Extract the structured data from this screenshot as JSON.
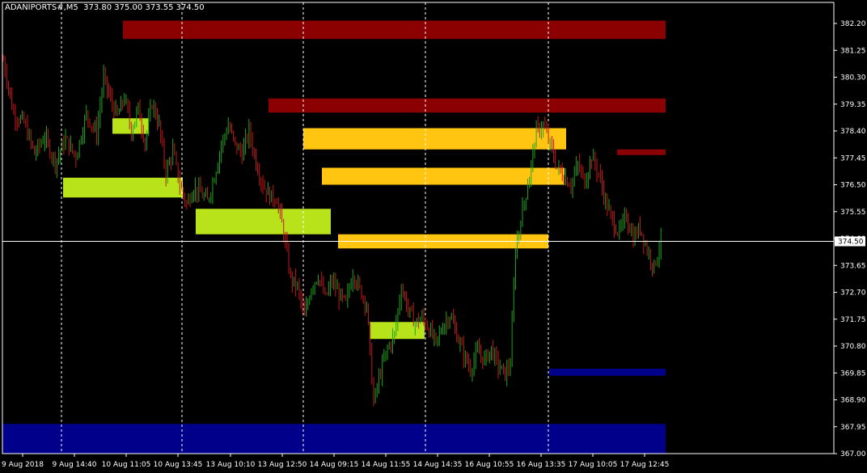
{
  "header": {
    "symbol": "ADANIPORTS#,M5",
    "ohlc": "373.80 375.00 373.55 374.50"
  },
  "colors": {
    "background": "#000000",
    "bull": "#1fa51f",
    "bear": "#c41a1a",
    "supply_zone": "#8b0000",
    "demand_zone": "#00008b",
    "lime_zone": "#b8e21a",
    "orange_zone": "#ffc510",
    "grid": "#ffffff",
    "text": "#ffffff"
  },
  "chart_data": {
    "type": "candlestick",
    "y_ticks": [
      "382.20",
      "381.25",
      "380.30",
      "379.35",
      "378.40",
      "377.45",
      "376.50",
      "375.55",
      "374.60",
      "373.65",
      "372.70",
      "371.75",
      "370.80",
      "369.85",
      "368.90",
      "367.95",
      "367.00"
    ],
    "ylim": [
      367.0,
      382.2
    ],
    "x_ticks": [
      "9 Aug 2018",
      "9 Aug 14:40",
      "10 Aug 11:05",
      "10 Aug 13:45",
      "13 Aug 10:10",
      "13 Aug 12:50",
      "14 Aug 09:15",
      "14 Aug 11:55",
      "14 Aug 14:35",
      "16 Aug 10:55",
      "16 Aug 13:35",
      "17 Aug 10:05",
      "17 Aug 12:45"
    ],
    "current_price": "374.50",
    "current_value": 374.5,
    "bar_count": 205,
    "price_path": [
      [
        0,
        380.9
      ],
      [
        6,
        379.0
      ],
      [
        12,
        378.7
      ],
      [
        18,
        377.6
      ],
      [
        24,
        378.2
      ],
      [
        30,
        377.3
      ],
      [
        36,
        378.1
      ],
      [
        42,
        377.5
      ],
      [
        48,
        379.0
      ],
      [
        54,
        378.3
      ],
      [
        58,
        380.3
      ],
      [
        62,
        379.5
      ],
      [
        66,
        378.9
      ],
      [
        70,
        379.6
      ],
      [
        74,
        378.4
      ],
      [
        78,
        379.2
      ],
      [
        82,
        378.0
      ],
      [
        86,
        379.4
      ],
      [
        90,
        378.6
      ],
      [
        94,
        376.9
      ],
      [
        98,
        377.7
      ],
      [
        102,
        376.5
      ],
      [
        106,
        375.8
      ],
      [
        110,
        376.4
      ],
      [
        114,
        376.2
      ],
      [
        118,
        375.9
      ],
      [
        122,
        376.8
      ],
      [
        126,
        377.9
      ],
      [
        130,
        378.6
      ],
      [
        134,
        377.9
      ],
      [
        138,
        377.6
      ],
      [
        142,
        378.4
      ],
      [
        146,
        377.3
      ],
      [
        150,
        376.5
      ],
      [
        154,
        376.1
      ],
      [
        158,
        376.0
      ],
      [
        162,
        374.8
      ],
      [
        166,
        373.2
      ],
      [
        170,
        372.9
      ],
      [
        174,
        371.8
      ],
      [
        178,
        372.9
      ],
      [
        182,
        373.3
      ],
      [
        186,
        372.5
      ],
      [
        190,
        373.1
      ],
      [
        194,
        372.6
      ],
      [
        198,
        372.3
      ],
      [
        202,
        373.4
      ],
      [
        206,
        372.8
      ],
      [
        210,
        372.3
      ],
      [
        214,
        368.8
      ],
      [
        218,
        369.9
      ],
      [
        222,
        370.7
      ],
      [
        226,
        371.2
      ],
      [
        230,
        372.9
      ],
      [
        234,
        372.1
      ],
      [
        238,
        371.6
      ],
      [
        242,
        371.8
      ],
      [
        246,
        371.4
      ],
      [
        250,
        370.9
      ],
      [
        254,
        371.5
      ],
      [
        258,
        371.9
      ],
      [
        262,
        371.2
      ],
      [
        266,
        370.5
      ],
      [
        270,
        370.0
      ],
      [
        274,
        370.6
      ],
      [
        278,
        370.3
      ],
      [
        282,
        370.7
      ],
      [
        286,
        370.1
      ],
      [
        290,
        369.8
      ],
      [
        293,
        370.2
      ],
      [
        296,
        374.2
      ],
      [
        300,
        375.6
      ],
      [
        304,
        376.8
      ],
      [
        308,
        378.4
      ],
      [
        312,
        378.6
      ],
      [
        316,
        377.9
      ],
      [
        320,
        377.1
      ],
      [
        324,
        376.8
      ],
      [
        328,
        376.5
      ],
      [
        332,
        377.2
      ],
      [
        336,
        376.6
      ],
      [
        340,
        377.5
      ],
      [
        344,
        376.9
      ],
      [
        348,
        375.9
      ],
      [
        352,
        375.2
      ],
      [
        356,
        374.8
      ],
      [
        360,
        375.4
      ],
      [
        364,
        374.6
      ],
      [
        368,
        375.0
      ],
      [
        372,
        374.2
      ],
      [
        376,
        373.6
      ],
      [
        380,
        374.5
      ]
    ],
    "zones": [
      {
        "kind": "supply",
        "top": 382.3,
        "bottom": 381.65,
        "x_from": "10 Aug 11:05"
      },
      {
        "kind": "supply",
        "top": 379.55,
        "bottom": 379.05,
        "x_from": "13 Aug 10:10"
      },
      {
        "kind": "supply",
        "top": 377.75,
        "bottom": 377.55,
        "x_from": "17 Aug 10:05"
      },
      {
        "kind": "orange",
        "top": 378.5,
        "bottom": 377.75,
        "x_from": "13 Aug 12:50",
        "x_to": "16 Aug 13:35"
      },
      {
        "kind": "orange",
        "top": 377.1,
        "bottom": 376.5,
        "x_from": "13 Aug 12:50",
        "x_to": "16 Aug 13:35"
      },
      {
        "kind": "orange",
        "top": 374.75,
        "bottom": 374.25,
        "x_from": "14 Aug 09:15",
        "x_to": "16 Aug 13:35"
      },
      {
        "kind": "lime",
        "top": 378.85,
        "bottom": 378.3,
        "x_from": "10 Aug 11:05",
        "x_to": "10 Aug 13:45"
      },
      {
        "kind": "lime",
        "top": 376.75,
        "bottom": 376.05,
        "x_from": "9 Aug 14:40",
        "x_to": "10 Aug 13:45"
      },
      {
        "kind": "lime",
        "top": 375.65,
        "bottom": 374.75,
        "x_from": "10 Aug 13:45",
        "x_to": "14 Aug 09:15"
      },
      {
        "kind": "lime",
        "top": 371.65,
        "bottom": 371.05,
        "x_from": "14 Aug 11:55",
        "x_to": "14 Aug 14:35"
      },
      {
        "kind": "demand",
        "top": 370.0,
        "bottom": 369.75,
        "x_from": "16 Aug 13:35"
      },
      {
        "kind": "demand",
        "top": 368.05,
        "bottom": 367.0,
        "x_from": "9 Aug 2018"
      }
    ],
    "session_separators": [
      "9 Aug 14:40",
      "10 Aug 13:45",
      "13 Aug 12:50",
      "14 Aug 14:35",
      "16 Aug 13:35"
    ]
  }
}
